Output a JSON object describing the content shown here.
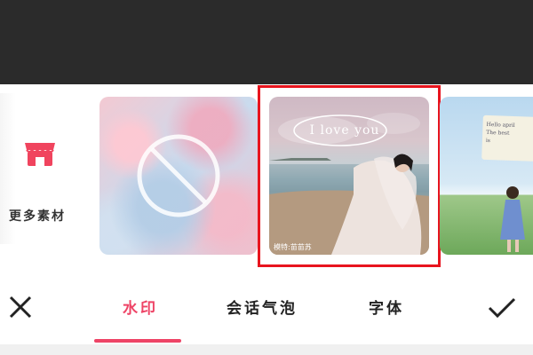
{
  "strip": {
    "more_label": "更多素材",
    "photo_overlay_text": "I love you",
    "photo_caption": "模特:苗苗苏",
    "note_card_lines": [
      "Hello april",
      "The best",
      "is"
    ]
  },
  "tabs": [
    {
      "label": "水印",
      "active": true
    },
    {
      "label": "会话气泡",
      "active": false
    },
    {
      "label": "字体",
      "active": false
    }
  ],
  "colors": {
    "accent": "#ee4466",
    "highlight_frame": "#e8141e",
    "top_bar": "#2b2b2b"
  },
  "icons": {
    "store": "store-icon",
    "none": "none-icon",
    "close": "close-icon",
    "confirm": "check-icon"
  }
}
